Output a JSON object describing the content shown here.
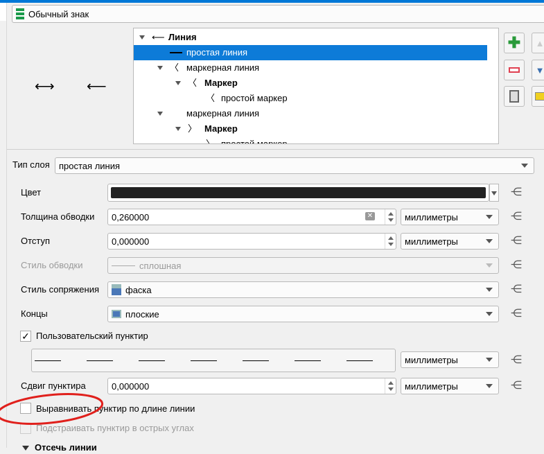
{
  "symbol_type": "Обычный знак",
  "tree": [
    {
      "label": "Линия",
      "bold": true,
      "icon": "arrow-left"
    },
    {
      "label": "простая линия",
      "selected": true,
      "icon": "line"
    },
    {
      "label": "маркерная линия",
      "icon": "chevron-left"
    },
    {
      "label": "Маркер",
      "bold": true,
      "icon": "chevron-left"
    },
    {
      "label": "простой маркер",
      "icon": "chevron-left"
    },
    {
      "label": "маркерная линия",
      "icon": "none"
    },
    {
      "label": "Маркер",
      "bold": true,
      "icon": "chevron-right"
    },
    {
      "label": "простой маркер",
      "icon": "chevron-right"
    }
  ],
  "layer_type": {
    "label": "Тип слоя",
    "value": "простая линия"
  },
  "props": {
    "color": {
      "label": "Цвет",
      "value": "#222222"
    },
    "width": {
      "label": "Толщина обводки",
      "value": "0,260000",
      "unit": "миллиметры"
    },
    "offset": {
      "label": "Отступ",
      "value": "0,000000",
      "unit": "миллиметры"
    },
    "stroke_style": {
      "label": "Стиль обводки",
      "value": "сплошная"
    },
    "join_style": {
      "label": "Стиль сопряжения",
      "value": "фаска"
    },
    "cap_style": {
      "label": "Концы",
      "value": "плоские"
    },
    "custom_dash": {
      "label": "Пользовательский пунктир",
      "checked": true,
      "unit": "миллиметры"
    },
    "dash_offset": {
      "label": "Сдвиг пунктира",
      "value": "0,000000",
      "unit": "миллиметры"
    },
    "align_dash": {
      "label": "Выравнивать пунктир по длине линии",
      "checked": false
    },
    "tweak_dash": {
      "label": "Подстраивать пунктир в острых углах",
      "checked": false
    },
    "clip_section": {
      "label": "Отсечь линии"
    }
  },
  "annotation_color": "#e0201c"
}
